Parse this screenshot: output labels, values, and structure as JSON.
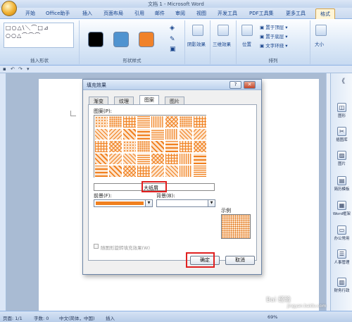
{
  "window": {
    "title": "文档 1 - Microsoft Word"
  },
  "tabs": [
    "开始",
    "Office助手",
    "插入",
    "页面布局",
    "引用",
    "邮件",
    "审阅",
    "视图",
    "开发工具",
    "PDF工具集",
    "更多工具",
    "格式"
  ],
  "active_tab": "格式",
  "ribbon": {
    "insert_shapes_label": "插入形状",
    "shape_styles_label": "形状样式",
    "shadow_label": "阴影效果",
    "threed_label": "三维效果",
    "position_label": "位置",
    "front_label": "置于顶层",
    "back_label": "置于底层",
    "wrap_label": "文字环绕",
    "arrange_label": "排列",
    "size_label": "大小",
    "shapes_glyphs": "□○△\\＼⌒□⊿\n○○△⌒⌒⌒",
    "swatch_colors": [
      "#000000",
      "#4f93d0",
      "#f0822a"
    ]
  },
  "dialog": {
    "title": "填充效果",
    "help_btn": "?",
    "close_btn": "✕",
    "tabs": [
      "渐变",
      "纹理",
      "图案",
      "图片"
    ],
    "active_tab": "图案",
    "pattern_label": "图案(P):",
    "selected_pattern_name": "大纸屑",
    "fg_label": "前景(F):",
    "bg_label": "背景(B):",
    "example_label": "示例",
    "rotate_checkbox_label": "随图形旋转填充效果(W)",
    "ok_btn": "确定",
    "cancel_btn": "取消",
    "fg_color": "#f08020",
    "bg_color": "#ffffff"
  },
  "right_panel": {
    "items": [
      "图形",
      "插图库",
      "图片",
      "简历模板",
      "Word框架",
      "办公常用",
      "人事管理",
      "财务行政"
    ]
  },
  "statusbar": {
    "page": "页面: 1/1",
    "words": "字数: 0",
    "language": "中文(简体，中国)",
    "insert_mode": "插入",
    "zoom": "69%"
  },
  "watermark": {
    "line1": "Bai 经验",
    "line2": "jingyan.baidu.com"
  }
}
